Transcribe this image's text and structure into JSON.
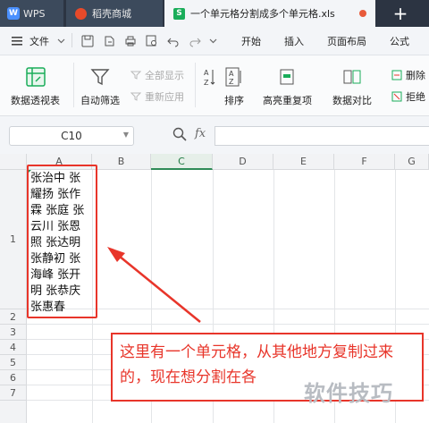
{
  "tabs": {
    "wps": "WPS",
    "store": "稻壳商城",
    "file": "一个单元格分割成多个单元格.xls",
    "add": "+"
  },
  "menu": {
    "file": "文件",
    "start": "开始",
    "insert": "插入",
    "layout": "页面布局",
    "formula": "公式"
  },
  "ribbon": {
    "pivot": "数据透视表",
    "autofilter": "自动筛选",
    "show_all": "全部显示",
    "reapply": "重新应用",
    "sort": "排序",
    "highlight_dup": "高亮重复项",
    "compare": "数据对比",
    "remove": "删除",
    "reject": "拒绝"
  },
  "formula_bar": {
    "name_box": "C10",
    "fx": "fx",
    "value": ""
  },
  "columns": [
    "A",
    "B",
    "C",
    "D",
    "E",
    "F",
    "G"
  ],
  "selected_column": "C",
  "rows": [
    "1",
    "2",
    "3",
    "4",
    "5",
    "6",
    "7"
  ],
  "cell_a1": "张治中 张耀扬 张作霖 张庭 张云川 张恩照 张达明 张静初 张海峰 张开明 张恭庆 张惠春",
  "annotation": "这里有一个单元格，从其他地方复制过来的，现在想分割在各",
  "watermark": "软件技巧",
  "colors": {
    "annotation_red": "#e8352a",
    "selected_green": "#2e8b57",
    "title_bar": "#2c3442"
  }
}
